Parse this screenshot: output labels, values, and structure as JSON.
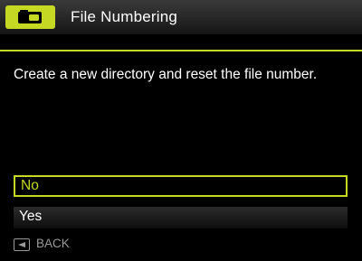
{
  "header": {
    "category_icon": "camera-setup-icon",
    "title": "File Numbering"
  },
  "description": "Create a new directory and  reset the file number.",
  "options": [
    {
      "label": "No",
      "selected": true
    },
    {
      "label": "Yes",
      "selected": false
    }
  ],
  "footer": {
    "back_icon": "left-arrow-button-icon",
    "back_label": "BACK"
  },
  "colors": {
    "accent": "#c4d824",
    "background": "#000000",
    "text": "#ffffff",
    "muted": "#9a9a9a"
  }
}
